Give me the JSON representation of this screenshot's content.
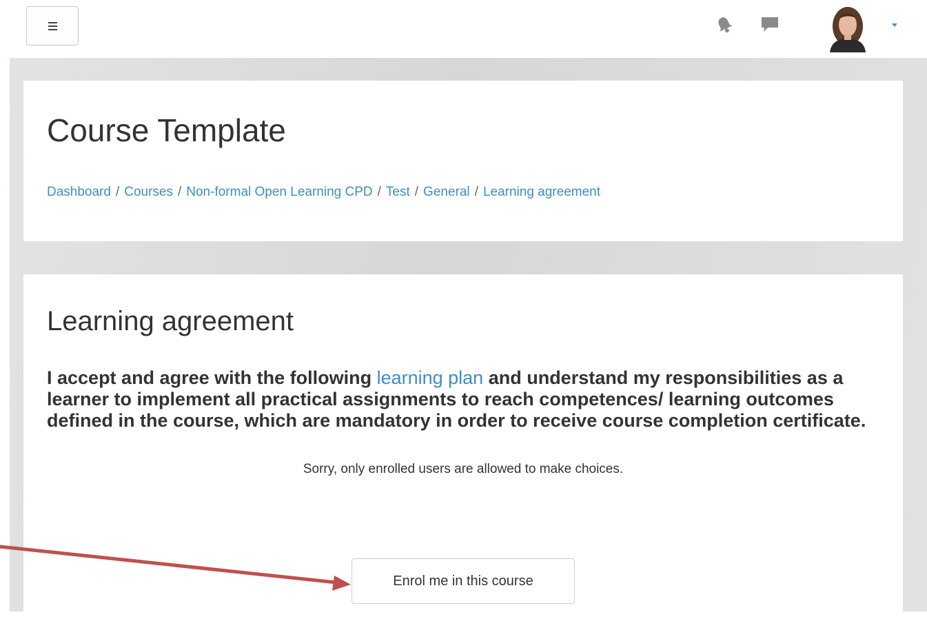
{
  "navbar": {
    "menu_icon": "hamburger-icon",
    "notifications_icon": "bell-icon",
    "messages_icon": "speech-bubble-icon",
    "user_menu_icon": "caret-down-icon"
  },
  "header": {
    "title": "Course Template",
    "breadcrumb": [
      "Dashboard",
      "Courses",
      "Non-formal Open Learning CPD",
      "Test",
      "General",
      "Learning agreement"
    ],
    "separator": "/"
  },
  "main": {
    "heading": "Learning agreement",
    "agreement_before": "I accept and agree with the following ",
    "agreement_link": "learning plan",
    "agreement_after": " and understand my responsibilities as a learner to implement all practical assignments to reach competences/ learning outcomes defined in the course, which are mandatory in order to receive course completion certificate.",
    "notice": "Sorry, only enrolled users are allowed to make choices.",
    "enrol_button": "Enrol me in this course"
  },
  "colors": {
    "link": "#3d8fc6",
    "annotation_arrow": "#c0504d",
    "page_background": "#dcdddf"
  }
}
